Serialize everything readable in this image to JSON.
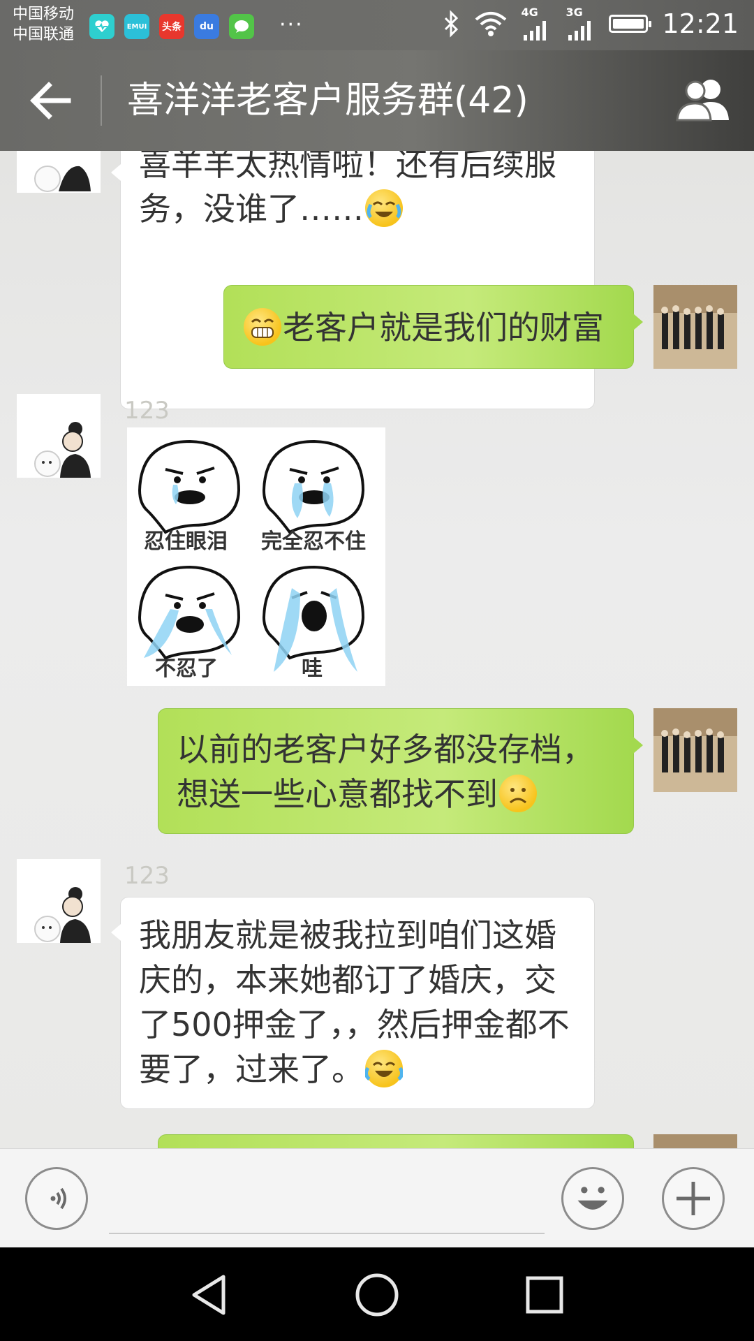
{
  "status_bar": {
    "carrier_1": "中国移动",
    "carrier_2": "中国联通",
    "app_icons": [
      {
        "name": "health-app-icon",
        "label": "",
        "color": "#2ecfcf"
      },
      {
        "name": "emui-app-icon",
        "label": "EMUI",
        "color": "#2bc0d8"
      },
      {
        "name": "toutiao-app-icon",
        "label": "头条",
        "color": "#e8372d"
      },
      {
        "name": "baidu-app-icon",
        "label": "du",
        "color": "#3a7be0"
      },
      {
        "name": "wechat-app-icon",
        "label": "",
        "color": "#52c448"
      }
    ],
    "more": "···",
    "network_1": "4G",
    "network_2": "3G",
    "time": "12:21"
  },
  "header": {
    "title": "喜洋洋老客户服务群(42)",
    "back_icon": "arrow-left-icon",
    "members_icon": "group-members-icon"
  },
  "messages": [
    {
      "direction": "in",
      "text": "喜羊羊太热情啦！还有后续服务，没谁了……",
      "emoji": "laugh-cry-emoji"
    },
    {
      "direction": "out",
      "text": "老客户就是我们的财富",
      "emoji": "grin-emoji"
    },
    {
      "direction": "in",
      "nickname": "123",
      "sticker": {
        "captions": [
          "忍住眼泪",
          "完全忍不住",
          "不忍了",
          "哇"
        ]
      }
    },
    {
      "direction": "out",
      "text": "以前的老客户好多都没存档，想送一些心意都找不到",
      "emoji": "frown-emoji"
    },
    {
      "direction": "in",
      "nickname": "123",
      "text": "我朋友就是被我拉到咱们这婚庆的，本来她都订了婚庆，交了500押金了，，然后押金都不要了，过来了。",
      "emoji": "tears-of-joy-emoji"
    }
  ],
  "input_bar": {
    "voice_icon": "voice-input-icon",
    "emoji_icon": "smiley-icon",
    "plus_icon": "plus-icon"
  },
  "nav_bar": {
    "back": "nav-back-icon",
    "home": "nav-home-icon",
    "recent": "nav-recent-icon"
  },
  "colors": {
    "outgoing_bubble": "#b2e058",
    "incoming_bubble": "#ffffff",
    "header_bg": "#6e6e6b"
  }
}
